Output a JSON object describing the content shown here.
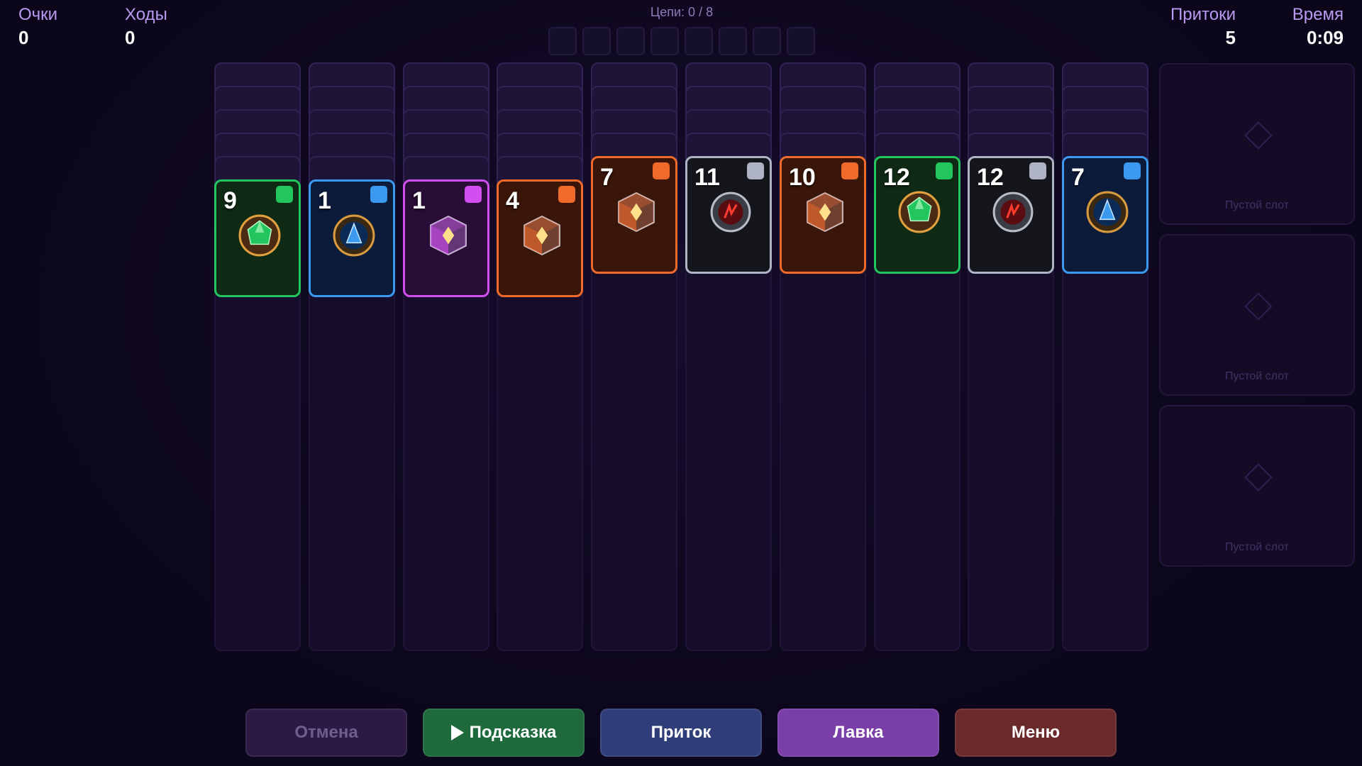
{
  "hud": {
    "score_label": "Очки",
    "score_value": "0",
    "moves_label": "Ходы",
    "moves_value": "0",
    "chains_label": "Цепи: 0 / 8",
    "draws_label": "Притоки",
    "draws_value": "5",
    "time_label": "Время",
    "time_value": "0:09"
  },
  "chain_slots_count": 8,
  "columns": [
    {
      "facedown": 5,
      "card": {
        "value": "9",
        "color": "green",
        "icon": "green-emerald-gem-icon"
      }
    },
    {
      "facedown": 5,
      "card": {
        "value": "1",
        "color": "blue",
        "icon": "blue-crystal-orb-icon"
      }
    },
    {
      "facedown": 5,
      "card": {
        "value": "1",
        "color": "purple",
        "icon": "purple-rune-cube-icon"
      }
    },
    {
      "facedown": 5,
      "card": {
        "value": "4",
        "color": "orange",
        "icon": "orange-crystal-cube-icon"
      }
    },
    {
      "facedown": 4,
      "card": {
        "value": "7",
        "color": "orange",
        "icon": "orange-crystal-cube-icon"
      }
    },
    {
      "facedown": 4,
      "card": {
        "value": "11",
        "color": "gray",
        "icon": "red-lightning-rune-icon"
      }
    },
    {
      "facedown": 4,
      "card": {
        "value": "10",
        "color": "orange",
        "icon": "orange-crystal-cube-icon"
      }
    },
    {
      "facedown": 4,
      "card": {
        "value": "12",
        "color": "green",
        "icon": "green-emerald-gem-icon"
      }
    },
    {
      "facedown": 4,
      "card": {
        "value": "12",
        "color": "gray",
        "icon": "red-lightning-rune-icon"
      }
    },
    {
      "facedown": 4,
      "card": {
        "value": "7",
        "color": "blue",
        "icon": "blue-crystal-orb-icon"
      }
    }
  ],
  "side_slots": [
    {
      "label": "Пустой слот",
      "icon": "diamond-outline-icon"
    },
    {
      "label": "Пустой слот",
      "icon": "diamond-outline-icon"
    },
    {
      "label": "Пустой слот",
      "icon": "diamond-outline-icon"
    }
  ],
  "buttons": {
    "undo": "Отмена",
    "hint": "Подсказка",
    "draw": "Приток",
    "shop": "Лавка",
    "menu": "Меню"
  },
  "colors": {
    "green": "#22c55e",
    "blue": "#3b9af0",
    "purple": "#d24ef0",
    "orange": "#f06a2b",
    "gray": "#aeb4c4",
    "background": "#0e0820"
  }
}
